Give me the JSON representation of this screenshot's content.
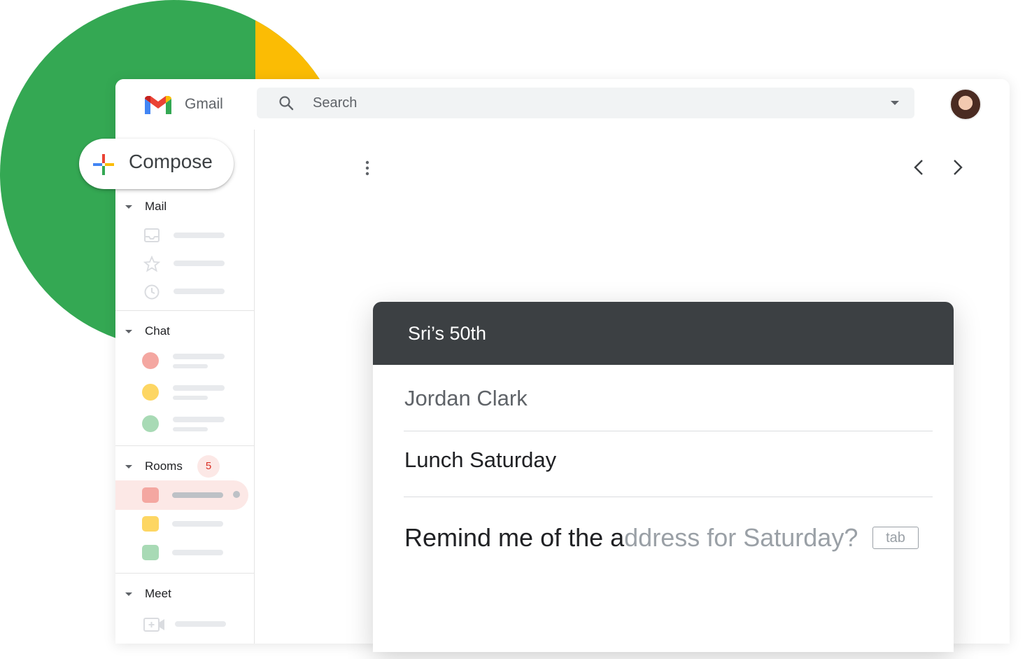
{
  "app": {
    "name": "Gmail"
  },
  "search": {
    "placeholder": "Search"
  },
  "compose": {
    "label": "Compose"
  },
  "sidebar": {
    "mail": {
      "label": "Mail"
    },
    "chat": {
      "label": "Chat"
    },
    "rooms": {
      "label": "Rooms",
      "badge": "5"
    },
    "meet": {
      "label": "Meet"
    }
  },
  "message": {
    "title": "Sri’s 50th",
    "to": "Jordan Clark",
    "subject": "Lunch Saturday",
    "body_typed": "Remind me of the a",
    "body_suggestion": "ddress for Saturday?",
    "tab_hint": "tab"
  },
  "colors": {
    "green": "#34a853",
    "yellow": "#fbbc04",
    "red_light": "#f4a7a1",
    "yellow_light": "#fdd663",
    "green_light": "#a8dab5",
    "dialog_header": "#3c4043"
  },
  "icons": [
    "gmail-logo-icon",
    "search-icon",
    "chevron-down-icon",
    "more-vert-icon",
    "chevron-left-icon",
    "chevron-right-icon",
    "inbox-icon",
    "star-icon",
    "clock-icon",
    "video-icon",
    "plus-icon"
  ]
}
